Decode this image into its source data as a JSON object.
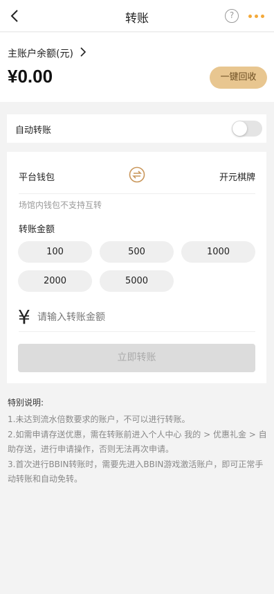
{
  "header": {
    "title": "转账",
    "help_glyph": "?",
    "back_icon": "chevron-left-icon",
    "more_icon": "more-dots-icon",
    "accent_color": "#f3a93a"
  },
  "balance": {
    "label": "主账户余额(元)",
    "amount": "¥0.00",
    "reclaim_button": "一键回收",
    "reclaim_color": "#e8c690"
  },
  "auto_transfer": {
    "label": "自动转账",
    "enabled": false
  },
  "transfer": {
    "from_wallet": "平台钱包",
    "to_wallet": "开元棋牌",
    "swap_icon": "swap-icon",
    "note": "场馆内钱包不支持互转",
    "amount_label": "转账金额",
    "quick_amounts": [
      "100",
      "500",
      "1000",
      "2000",
      "5000"
    ],
    "currency_symbol": "¥",
    "input_placeholder": "请输入转账金额",
    "submit_label": "立即转账"
  },
  "notes": {
    "title": "特别说明:",
    "items": [
      "1.未达到流水倍数要求的账户，不可以进行转账。",
      "2.如需申请存送优惠，需在转账前进入个人中心 我的 > 优惠礼金 > 自助存送，进行申请操作，否则无法再次申请。",
      "3.首次进行BBIN转账时，需要先进入BBIN游戏激活账户，即可正常手动转账和自动免转。"
    ]
  }
}
